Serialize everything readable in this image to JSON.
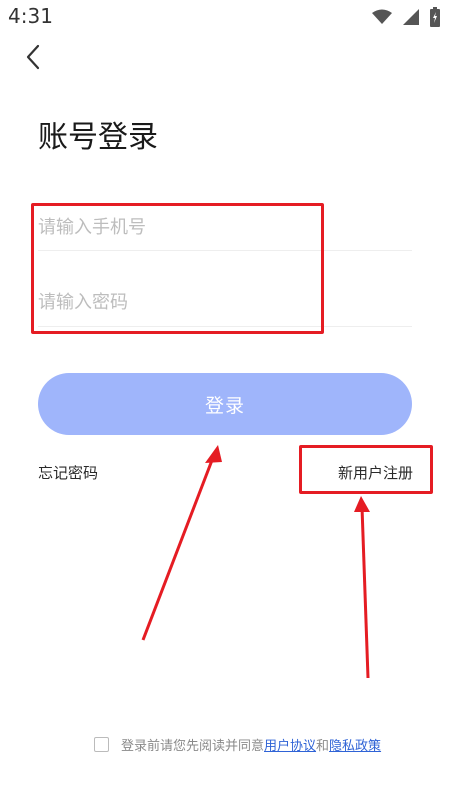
{
  "status_bar": {
    "time": "4:31"
  },
  "page_title": "账号登录",
  "form": {
    "phone_placeholder": "请输入手机号",
    "password_placeholder": "请输入密码"
  },
  "buttons": {
    "login_label": "登录",
    "forgot_password": "忘记密码",
    "register": "新用户注册"
  },
  "agreement": {
    "prefix": "登录前请您先阅读并同意",
    "user_agreement": "用户协议",
    "conjunction": "和",
    "privacy_policy": "隐私政策"
  },
  "colors": {
    "login_button": "#9fb5fb",
    "link_blue": "#2f63d6",
    "annotation_red": "#e51c23"
  }
}
